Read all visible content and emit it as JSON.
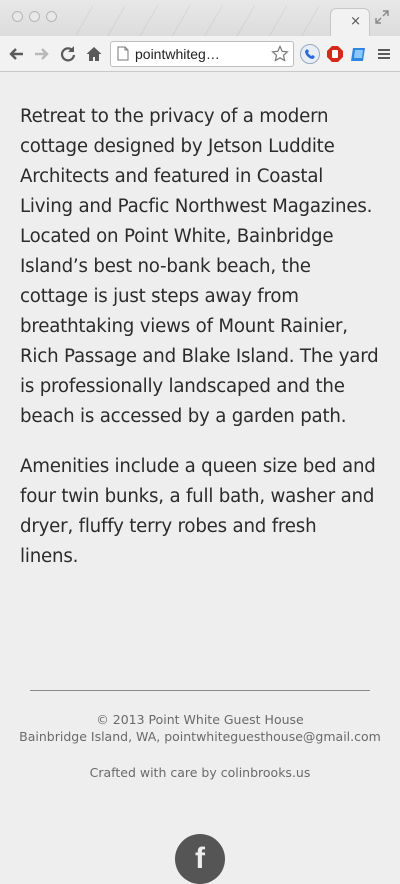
{
  "browser": {
    "tab_close_glyph": "×",
    "url": "pointwhiteg…",
    "colors": {
      "ext_phone": "#2c6ad8",
      "ext_stop": "#d42a1a",
      "ext_shield": "#2f86e0"
    }
  },
  "content": {
    "paragraph_1": "Retreat to the privacy of a modern cottage designed by Jetson Luddite Architects and featured in Coastal Living and Pacfic Northwest Magazines. Located on Point White, Bainbridge Island’s best no-bank beach, the cottage is just steps away from breathtaking views of Mount Rainier, Rich Passage and Blake Island. The yard is professionally landscaped and the beach is accessed by a garden path.",
    "paragraph_2": "Amenities include a queen size bed and four twin bunks, a full bath, washer and dryer, fluffy terry robes and fresh linens."
  },
  "footer": {
    "copyright": "© 2013 Point White Guest House",
    "address": "Bainbridge Island, WA, pointwhiteguesthouse@gmail.com",
    "credit": "Crafted with care by colinbrooks.us",
    "facebook_glyph": "f"
  }
}
